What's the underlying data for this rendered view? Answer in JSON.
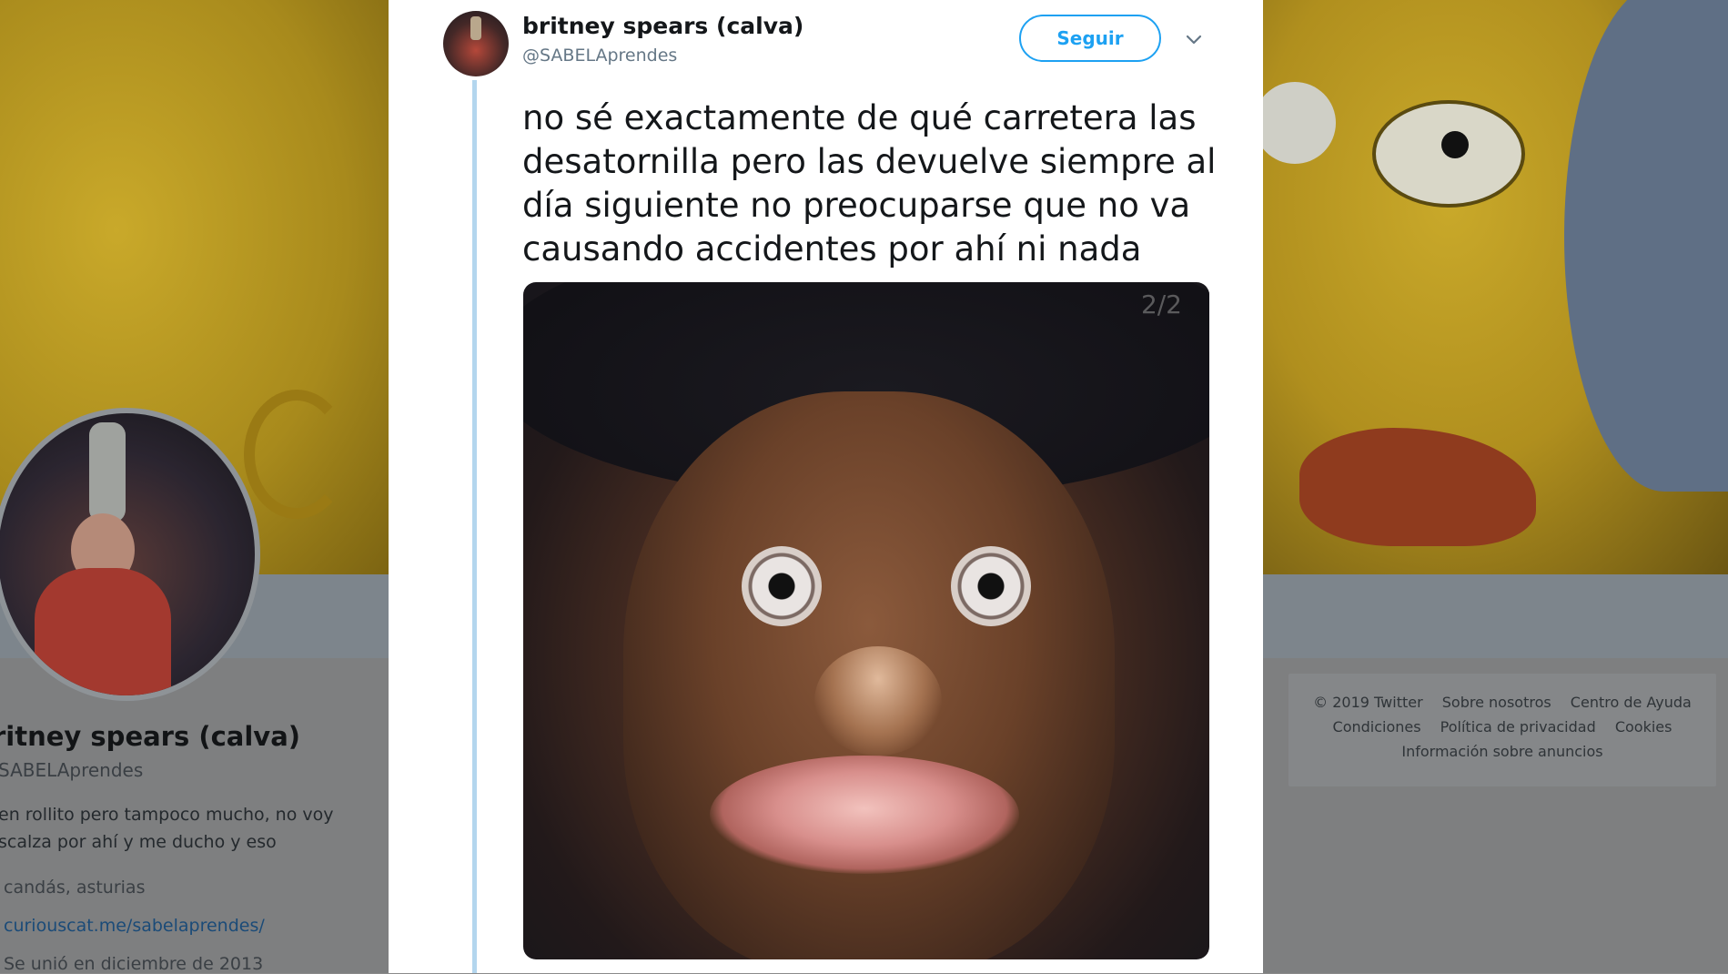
{
  "background_profile": {
    "name": "ritney spears (calva)",
    "handle": "SABELAprendes",
    "bio_line1": "en rollito pero tampoco mucho, no voy",
    "bio_line2": "scalza por ahí y me ducho y eso",
    "location": "candás, asturias",
    "link": "curiouscat.me/sabelaprendes/",
    "joined": "Se unió en diciembre de 2013"
  },
  "footer": {
    "links_row1": [
      "© 2019 Twitter",
      "Sobre nosotros",
      "Centro de Ayuda"
    ],
    "links_row2": [
      "Condiciones",
      "Política de privacidad",
      "Cookies"
    ],
    "links_row3": [
      "Información sobre anuncios"
    ]
  },
  "tweet": {
    "author_name": "britney spears (calva)",
    "author_handle": "@SABELAprendes",
    "follow_label": "Seguir",
    "text_lines": [
      "no sé exactamente de qué carretera las",
      "desatornilla pero las devuelve siempre al",
      "día siguiente no preocuparse que no va",
      "causando accidentes por ahí ni nada"
    ],
    "media_counter": "2/2"
  },
  "colors": {
    "accent": "#1da1f2",
    "thread_line": "#b3d6ee",
    "text_primary": "#14171a",
    "text_secondary": "#657786"
  },
  "icons": {
    "chevron": "chevron-down-icon"
  }
}
